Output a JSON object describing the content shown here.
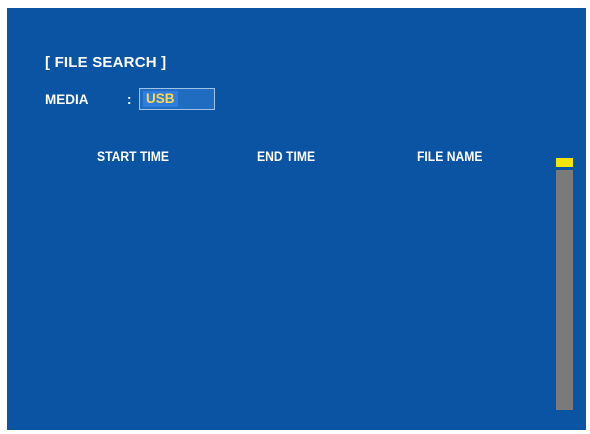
{
  "title": "[ FILE SEARCH ]",
  "media": {
    "label": "MEDIA",
    "separator": ":",
    "value": "USB"
  },
  "columns": [
    "START TIME",
    "END TIME",
    "FILE NAME"
  ],
  "results": [],
  "scroll": {
    "position_fraction": 0.0
  },
  "colors": {
    "background": "#0b53a3",
    "text": "#ffffff",
    "value_text": "#ffd84a",
    "scrollbar_track": "#7a7a7a",
    "scrollbar_thumb": "#f2e600"
  }
}
